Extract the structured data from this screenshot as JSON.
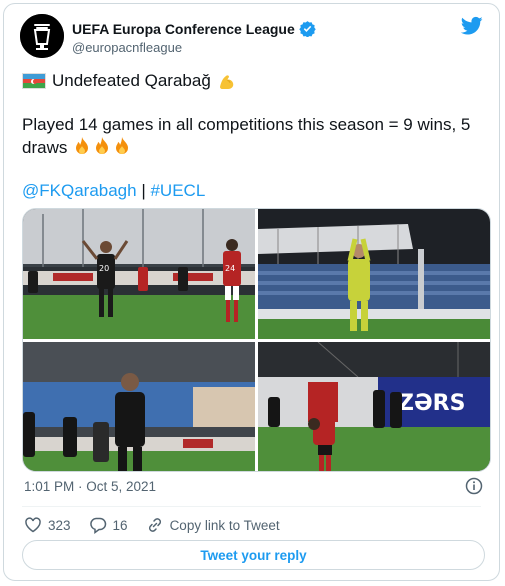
{
  "tweet": {
    "display_name": "UEFA Europa Conference League",
    "handle": "@europacnfleague",
    "line1": "Undefeated Qarabağ",
    "line2": "Played 14 games in all competitions this season = 9 wins, 5 draws",
    "mention": "@FKQarabagh",
    "separator": " | ",
    "hashtag": "#UECL",
    "timestamp": "1:01 PM · Oct 5, 2021",
    "likes": "323",
    "replies": "16",
    "copy_link_label": "Copy link to Tweet",
    "reply_button_label": "Tweet your reply",
    "photo4_sponsor": "ZƏRS",
    "photo1_shirt_number": "20",
    "photo1_opponent_number": "24"
  },
  "colors": {
    "accent": "#1d9bf0",
    "text": "#0f1419",
    "secondary_text": "#536471",
    "border": "#cfd9de"
  },
  "icons": [
    "avatar-logo",
    "verified-icon",
    "twitter-bird-icon",
    "azerbaijan-flag-icon",
    "flexed-biceps-icon",
    "fire-icon",
    "info-icon",
    "heart-icon",
    "reply-icon",
    "link-icon"
  ]
}
